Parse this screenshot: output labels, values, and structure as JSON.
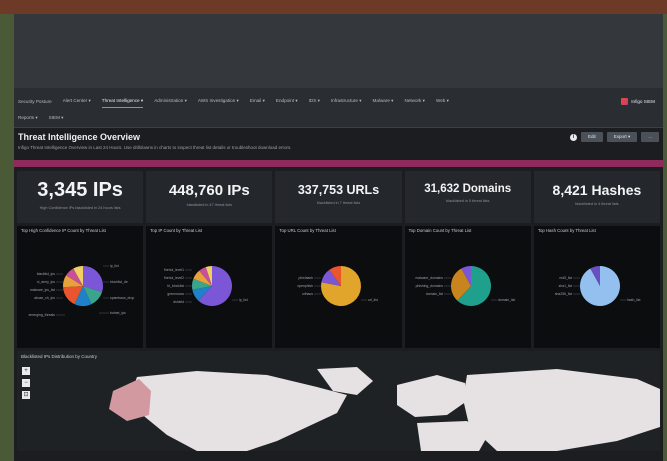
{
  "nav": {
    "row1": [
      "Security Posture",
      "Alert Center ▾",
      "Threat Intelligence ▾",
      "Administration ▾",
      "AWS Investigation ▾",
      "Email ▾",
      "Endpoint ▾",
      "IDS ▾",
      "Infrastructure ▾",
      "Malware ▾",
      "Network ▾",
      "Web ▾"
    ],
    "row2": [
      "Reports ▾",
      "SIEM ▾"
    ],
    "active_index": 2,
    "brand": "Infigo SIEM"
  },
  "header": {
    "title": "Threat Intelligence Overview",
    "subtitle": "Infigo Threat Intelligence Overview in Last 24 Hours. Use drilldowns in charts to inspect threat list details or troubleshoot download errors.",
    "edit_label": "Edit",
    "export_label": "Export ▾",
    "more_label": "..."
  },
  "kpis": [
    {
      "value": "3,345 IPs",
      "label": "High Confidence IPs blacklisted in 24 hours lists"
    },
    {
      "value": "448,760 IPs",
      "label": "blacklisted in 47 threat lists"
    },
    {
      "value": "337,753 URLs",
      "label": "blacklisted in 7 threat lists"
    },
    {
      "value": "31,632 Domains",
      "label": "blacklisted in 5 threat lists"
    },
    {
      "value": "8,421 Hashes",
      "label": "blacklisted in 4 threat lists"
    }
  ],
  "charts": [
    {
      "title": "Top High Confidence IP Count by Threat List",
      "slices": [
        {
          "value": 30,
          "color": "#7b57d8"
        },
        {
          "value": 13,
          "color": "#3aa58c"
        },
        {
          "value": 14,
          "color": "#1f82c8"
        },
        {
          "value": 17,
          "color": "#e8552f"
        },
        {
          "value": 10,
          "color": "#e9a23b"
        },
        {
          "value": 8,
          "color": "#c84f9a"
        },
        {
          "value": 8,
          "color": "#f0d060"
        }
      ],
      "labels_left": [
        "blacklist_ips",
        "ci_army_ips",
        "malware_ips_list",
        "abuse_ch_ips"
      ],
      "labels_right": [
        "ip_list",
        "blocklist_de",
        "spamhaus_drop"
      ],
      "label_bottom_left": "emerging_threats",
      "label_bottom_right": "botnet_ips"
    },
    {
      "title": "Top IP Count by Threat List",
      "slices": [
        {
          "value": 62,
          "color": "#7b57d8"
        },
        {
          "value": 10,
          "color": "#1f82c8"
        },
        {
          "value": 9,
          "color": "#3aa58c"
        },
        {
          "value": 8,
          "color": "#e9a23b"
        },
        {
          "value": 6,
          "color": "#c84f9a"
        },
        {
          "value": 5,
          "color": "#f0d060"
        }
      ],
      "labels_left": [
        "firehol_level1",
        "firehol_level2",
        "bl_blocklist",
        "greensnow",
        "dshield"
      ],
      "labels_right": [
        "ip_list"
      ]
    },
    {
      "title": "Top URL Count by Threat List",
      "slices": [
        {
          "value": 78,
          "color": "#e2a52b"
        },
        {
          "value": 12,
          "color": "#7b57d8"
        },
        {
          "value": 10,
          "color": "#e8552f"
        }
      ],
      "labels_left": [
        "phishtank",
        "openphish",
        "urlhaus"
      ],
      "labels_right": [
        "url_list"
      ]
    },
    {
      "title": "Top Domain Count by Threat List",
      "slices": [
        {
          "value": 62,
          "color": "#1fa08c"
        },
        {
          "value": 30,
          "color": "#c8841d"
        },
        {
          "value": 8,
          "color": "#7b57d8"
        }
      ],
      "labels_left": [
        "malware_domains",
        "phishing_domains",
        "domain_list"
      ],
      "labels_right": [
        "domain_list"
      ]
    },
    {
      "title": "Top Hash Count by Threat List",
      "slices": [
        {
          "value": 92,
          "color": "#93c0ee"
        },
        {
          "value": 8,
          "color": "#6a4fc0"
        }
      ],
      "labels_left": [
        "md5_list",
        "sha1_list",
        "sha256_list"
      ],
      "labels_right": [
        "hash_list"
      ]
    }
  ],
  "map": {
    "title": "Blacklisted IPs Distribution by Country",
    "zoom_in": "+",
    "zoom_out": "−",
    "reset": "⊡",
    "land_color": "#e6e1e3",
    "highlight_color": "#d29aa0",
    "ocean_color": "#1f2225"
  }
}
